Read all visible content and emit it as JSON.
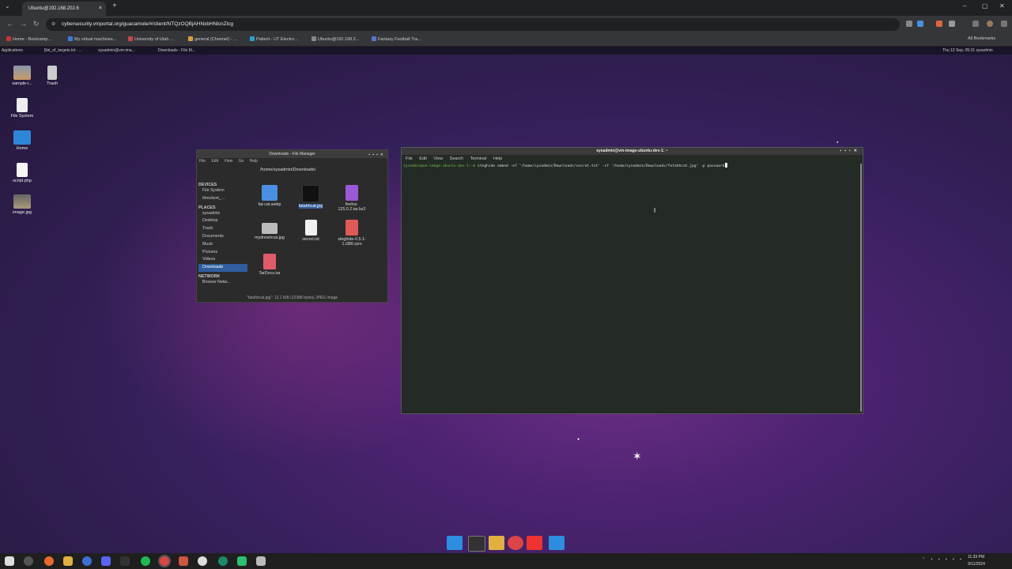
{
  "browser": {
    "tab_title": "Ubuntu@192.168.202.6",
    "tab_close": "×",
    "new_tab": "+",
    "tab_list": "⌄",
    "win_min": "–",
    "win_max": "▢",
    "win_close": "✕",
    "url": "cybersecurity.vmportal.org/guacamole/#/client/NTQzOQBjAHNxbHNlcnZlcg",
    "nav_back": "←",
    "nav_forward": "→",
    "nav_reload": "↻",
    "lock_icon": "⚙",
    "bookmarks": [
      "Home - Bootcamp...",
      "My virtual machines...",
      "University of Utah ...",
      "general (Channel) - ...",
      "Patient - UT Electro...",
      "Ubuntu@192.168.2...",
      "Fantasy Football Tra..."
    ],
    "all_bookmarks": "All Bookmarks"
  },
  "xfce_panel": {
    "applications": "Applications",
    "items": [
      "[list_of_targets.txt - ...",
      "sysadmin@vm-ima...",
      "Downloads - File M..."
    ],
    "clock": "Thu 12 Sep, 05:31  sysadmin"
  },
  "desktop_icons": [
    {
      "label": "sample-i...",
      "icon": "image-thumbnail-icon"
    },
    {
      "label": "Trash",
      "icon": "trash-icon"
    },
    {
      "label": "File System",
      "icon": "drive-icon"
    },
    {
      "label": "Home",
      "icon": "home-folder-icon"
    },
    {
      "label": "script.php",
      "icon": "php-file-icon"
    },
    {
      "label": "image.jpg",
      "icon": "image-thumbnail-icon"
    }
  ],
  "file_manager": {
    "title": "Downloads - File Manager",
    "menu": [
      "File",
      "Edit",
      "View",
      "Go",
      "Help"
    ],
    "location": "/home/sysadmin/Downloads/",
    "sidebar": {
      "devices_header": "DEVICES",
      "devices": [
        "File System",
        "thinclient_..."
      ],
      "places_header": "PLACES",
      "places": [
        "sysadmin",
        "Desktop",
        "Trash",
        "Documents",
        "Music",
        "Pictures",
        "Videos",
        "Downloads"
      ],
      "network_header": "NETWORK",
      "network": [
        "Browse Netw..."
      ]
    },
    "files": [
      {
        "name": "fat-cat.webp",
        "color": "#4a90e2"
      },
      {
        "name": "fatahhcat.jpg",
        "color": "#111111"
      },
      {
        "name": "firefox-125.0.2.tar.bz2",
        "color": "#9b59d6"
      },
      {
        "name": "mydreamcar.jpg",
        "color": "#bbbbbb"
      },
      {
        "name": "secret.txt",
        "color": "#f0f0f0"
      },
      {
        "name": "steghide-0.5.1-1.i386.rpm",
        "color": "#e05a5a"
      },
      {
        "name": "TarDocs.tar",
        "color": "#e05a6a"
      }
    ],
    "status": "\"fatahhcat.jpg\": 12.1 KiB (12388 bytes) JPEG image"
  },
  "terminal": {
    "title": "sysadmin@vm-image-ubuntu-dev-1: ~",
    "menu": [
      "File",
      "Edit",
      "View",
      "Search",
      "Terminal",
      "Help"
    ],
    "prompt": "sysadmin@vm-image-ubuntu-dev-1:~$",
    "command": " steghide embed -ef '/home/sysadmin/Downloads/secret.txt' -cf '/home/sysadmin/Downloads/fatahhcat.jpg' -p password"
  },
  "taskbar": {
    "time": "11:33 PM",
    "date": "9/11/2024"
  }
}
